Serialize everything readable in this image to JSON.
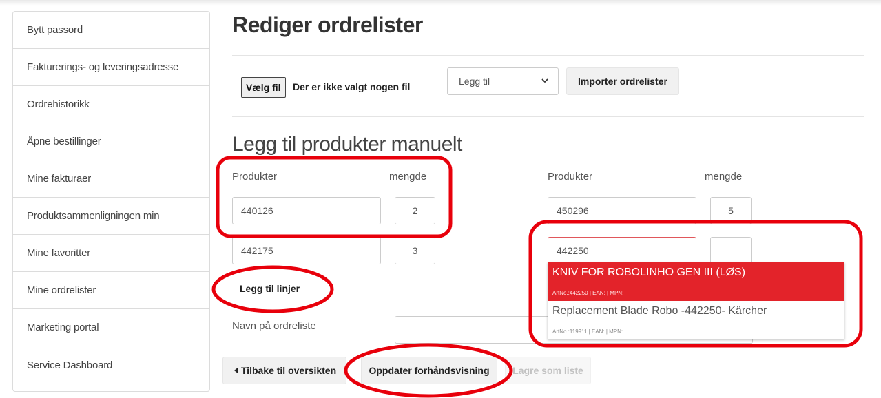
{
  "sidebar": {
    "items": [
      {
        "label": "Bytt passord"
      },
      {
        "label": "Fakturerings- og leveringsadresse"
      },
      {
        "label": "Ordrehistorikk"
      },
      {
        "label": "Åpne bestillinger"
      },
      {
        "label": "Mine fakturaer"
      },
      {
        "label": "Produktsammenligningen min"
      },
      {
        "label": "Mine favoritter"
      },
      {
        "label": "Mine ordrelister"
      },
      {
        "label": "Marketing portal"
      },
      {
        "label": "Service Dashboard"
      }
    ]
  },
  "page": {
    "title": "Rediger ordrelister"
  },
  "import": {
    "file_button": "Vælg fil",
    "file_status": "Der er ikke valgt nogen fil",
    "mode_selected": "Legg til",
    "import_button": "Importer ordrelister"
  },
  "manual": {
    "title": "Legg til produkter manuelt",
    "col_product": "Produkter",
    "col_qty": "mengde",
    "left_rows": [
      {
        "product": "440126",
        "qty": "2"
      },
      {
        "product": "442175",
        "qty": "3"
      }
    ],
    "right_rows": [
      {
        "product": "450296",
        "qty": "5"
      },
      {
        "product": "442250",
        "qty": ""
      }
    ],
    "add_lines": "Legg til linjer",
    "list_name_label": "Navn på ordreliste",
    "list_name_value": ""
  },
  "suggestions": [
    {
      "title": "KNIV FOR ROBOLINHO GEN III (LØS)",
      "meta": "ArtNo.:442250 | EAN: | MPN:"
    },
    {
      "title": "Replacement Blade Robo -442250- Kärcher",
      "meta": "ArtNo.:119911 | EAN: | MPN:"
    }
  ],
  "actions": {
    "back": "Tilbake til oversikten",
    "update_preview": "Oppdater forhåndsvisning",
    "save_list": "Lagre som liste"
  },
  "colors": {
    "accent_red": "#e3232a",
    "annotation_red": "#e8000b"
  },
  "icons": {
    "select_chevron": "chevron-down-icon",
    "back_caret": "caret-left-icon"
  }
}
